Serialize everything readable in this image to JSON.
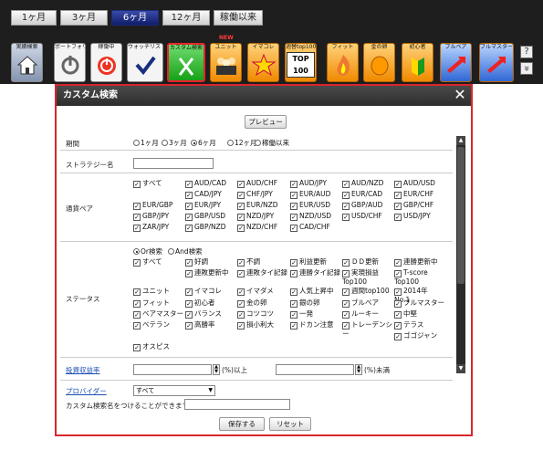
{
  "periods": [
    "1ヶ月",
    "3ヶ月",
    "6ヶ月",
    "12ヶ月",
    "稼働以来"
  ],
  "periods_active": "6ヶ月",
  "nav": {
    "live_label": "実績検索",
    "items": [
      "ポートフォリ",
      "稼働中",
      "ウォッチリスト",
      "カスタム検索",
      "ユニット",
      "イマコレ",
      "週替top100",
      "フィット",
      "金の卵",
      "初心者",
      "ブルベア",
      "ブルマスター"
    ],
    "new_badge": "NEW",
    "top100_text": "TOP 100",
    "help": "?",
    "more": "»"
  },
  "panel": {
    "title": "カスタム検索",
    "close": "✕",
    "preview": "プレビュー",
    "period_label": "期間",
    "period_options": [
      "1ヶ月",
      "3ヶ月",
      "6ヶ月",
      "12ヶ月",
      "稼働以来"
    ],
    "period_selected": "6ヶ月",
    "strategy_label": "ストラテジー名",
    "strategy_value": "",
    "pair_label": "通貨ペア",
    "pairs": [
      "すべて",
      "AUD/CAD",
      "AUD/CHF",
      "AUD/JPY",
      "AUD/NZD",
      "AUD/USD",
      "CAD/JPY",
      "CHF/JPY",
      "EUR/AUD",
      "EUR/CAD",
      "EUR/CHF",
      "EUR/GBP",
      "EUR/JPY",
      "EUR/NZD",
      "EUR/USD",
      "GBP/AUD",
      "GBP/CHF",
      "GBP/JPY",
      "GBP/USD",
      "NZD/JPY",
      "NZD/USD",
      "USD/CHF",
      "USD/JPY",
      "ZAR/JPY",
      "GBP/NZD",
      "NZD/CHF",
      "CAD/CHF"
    ],
    "status_label": "ステータス",
    "or_label": "Or検索",
    "and_label": "And検索",
    "statuses": [
      "すべて",
      "好調",
      "不調",
      "利益更新",
      "ＤＤ更新",
      "連勝更新中",
      "連敗更新中",
      "連敗タイ記録",
      "連勝タイ記録",
      "実現損益 Top100",
      "T-score Top100",
      "ユニット",
      "イマコレ",
      "イマダメ",
      "人気上昇中",
      "週間top100",
      "2014年 No.1",
      "フィット",
      "初心者",
      "金の卵",
      "銀の卵",
      "ブルベア",
      "ブルマスター",
      "ベアマスター",
      "バランス",
      "コツコツ",
      "一発",
      "ルーキー",
      "中堅",
      "ベテラン",
      "高勝率",
      "損小利大",
      "ドカン注意",
      "トレーデンシー",
      "テラス",
      "ゴゴジャン",
      "オスピス"
    ],
    "roi_label": "投資収益率",
    "roi_min_value": "",
    "roi_min_suffix": "(%)以上",
    "roi_max_value": "",
    "roi_max_suffix": "(%)未満",
    "provider_label": "プロバイダー",
    "provider_value": "すべて",
    "name_label": "カスタム検索名をつけることができます",
    "name_value": "",
    "save": "保存する",
    "reset": "リセット"
  },
  "colors": {
    "accent": "#d8262c",
    "active_period": "#1b2a7a",
    "header": "#2d2d2d",
    "link": "#1a4fb5"
  }
}
